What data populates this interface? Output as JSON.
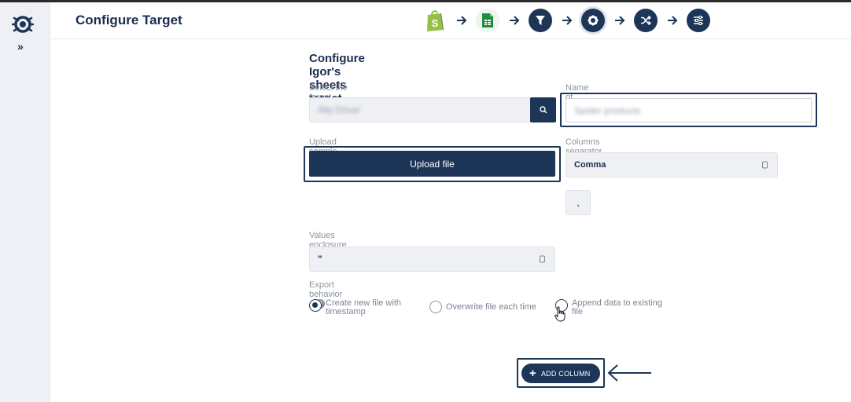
{
  "header": {
    "title": "Configure Target"
  },
  "sidebar": {
    "expand_icon": "double-chevron-right-icon"
  },
  "stepper": [
    {
      "icon": "shopify-bag-icon",
      "color": "#95bf47"
    },
    {
      "icon": "google-sheets-icon",
      "color": "#1e8e3e"
    },
    {
      "icon": "filter-icon",
      "color": "#1d3557"
    },
    {
      "icon": "gear-icon",
      "color": "#1d3557",
      "active": true
    },
    {
      "icon": "shuffle-icon",
      "color": "#1d3557"
    },
    {
      "icon": "sliders-icon",
      "color": "#1d3557"
    }
  ],
  "form": {
    "title": "Configure Igor's sheets target integration",
    "target_label": "Select the target spreadsheet file or folder",
    "target_value": "/My Drive/",
    "output_label": "Name of output file",
    "output_value": "Spider products",
    "upload_label": "Upload sample for setup",
    "upload_button": "Upload file",
    "separator_label": "Columns separator",
    "separator_value": "Comma",
    "separator_char": ",",
    "enclosure_label": "Values enclosure character",
    "enclosure_value": "\"",
    "export_label": "Export behavior",
    "export_options": [
      {
        "label": "Create new file with timestamp",
        "selected": true
      },
      {
        "label": "Overwrite file each time",
        "selected": false
      },
      {
        "label": "Append data to existing file",
        "selected": false
      }
    ],
    "add_column_button": "ADD COLUMN"
  },
  "colors": {
    "navy": "#1d3557",
    "title": "#1b2d4f",
    "muted": "#8d93a0"
  }
}
